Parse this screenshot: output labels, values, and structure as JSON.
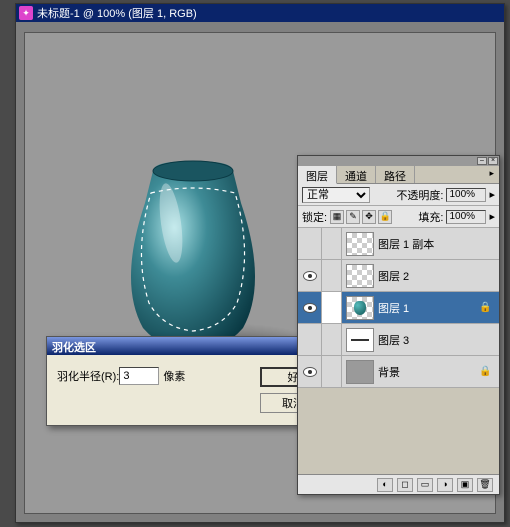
{
  "window": {
    "title": "未标题-1 @ 100% (图层 1, RGB)"
  },
  "dialog": {
    "title": "羽化选区",
    "radius_label": "羽化半径(R):",
    "radius_value": "3",
    "unit": "像素",
    "ok": "好",
    "cancel": "取消"
  },
  "panel": {
    "tabs": [
      "图层",
      "通道",
      "路径"
    ],
    "blend_mode": "正常",
    "opacity_label": "不透明度:",
    "opacity": "100%",
    "lock_label": "锁定:",
    "fill_label": "填充:",
    "fill": "100%",
    "layers": [
      {
        "name": "图层 1 副本",
        "visible": false,
        "thumb": "chk",
        "locked": false
      },
      {
        "name": "图层 2",
        "visible": true,
        "thumb": "chk",
        "locked": false
      },
      {
        "name": "图层 1",
        "visible": true,
        "thumb": "vase",
        "locked": true,
        "selected": true
      },
      {
        "name": "图层 3",
        "visible": false,
        "thumb": "line",
        "locked": false
      },
      {
        "name": "背景",
        "visible": true,
        "thumb": "gray",
        "locked": true
      }
    ]
  },
  "colors": {
    "vase_light": "#6ab8c0",
    "vase_dark": "#0e4450",
    "accent": "#3a6ea5"
  }
}
